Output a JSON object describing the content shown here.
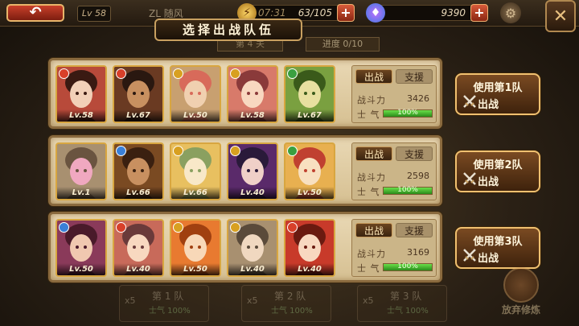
{
  "topbar": {
    "level": "Lv 58",
    "player_name": "ZL 随风",
    "energy_time": "07:31",
    "energy_value": "63/105",
    "gems_value": "9390"
  },
  "header": {
    "title": "选择出战队伍",
    "chapter": "第 4 关",
    "progress": "进度 0/10"
  },
  "teams": [
    {
      "tab_battle": "出战",
      "tab_support": "支援",
      "power_label": "战斗力",
      "power": "3426",
      "morale_label": "士  气",
      "morale_text": "100%",
      "morale_fraction": 1.0,
      "use_line1": "使用第1队",
      "use_line2": "出战",
      "heroes": [
        {
          "level": "Lv.58",
          "element": "fire",
          "palette": [
            "#b84a3a",
            "#f2d0b8",
            "#3a1a12"
          ]
        },
        {
          "level": "Lv.67",
          "element": "fire",
          "palette": [
            "#6a3a22",
            "#c89060",
            "#2a1810"
          ]
        },
        {
          "level": "Lv.50",
          "element": "light",
          "palette": [
            "#c8a070",
            "#f0d0b0",
            "#d86a5a"
          ]
        },
        {
          "level": "Lv.58",
          "element": "light",
          "palette": [
            "#d87a6a",
            "#f8d8c0",
            "#8a3a3a"
          ]
        },
        {
          "level": "Lv.67",
          "element": "wood",
          "palette": [
            "#7aa040",
            "#e8e0a0",
            "#3a5a1a"
          ]
        }
      ]
    },
    {
      "tab_battle": "出战",
      "tab_support": "支援",
      "power_label": "战斗力",
      "power": "2598",
      "morale_label": "士  气",
      "morale_text": "100%",
      "morale_fraction": 1.0,
      "use_line1": "使用第2队",
      "use_line2": "出战",
      "heroes": [
        {
          "level": "Lv.1",
          "element": "none",
          "palette": [
            "#a89070",
            "#f0a8c0",
            "#6a5440"
          ]
        },
        {
          "level": "Lv.66",
          "element": "water",
          "palette": [
            "#7a4a22",
            "#c89060",
            "#3a2010"
          ]
        },
        {
          "level": "Lv.66",
          "element": "light",
          "palette": [
            "#e8c060",
            "#f8e8c8",
            "#8aa060"
          ]
        },
        {
          "level": "Lv.40",
          "element": "light",
          "palette": [
            "#5a2a6a",
            "#f0d0c8",
            "#2a1a3a"
          ]
        },
        {
          "level": "Lv.50",
          "element": "wood",
          "palette": [
            "#e8b050",
            "#f8e0c0",
            "#c04030"
          ]
        }
      ]
    },
    {
      "tab_battle": "出战",
      "tab_support": "支援",
      "power_label": "战斗力",
      "power": "3169",
      "morale_label": "士  气",
      "morale_text": "100%",
      "morale_fraction": 1.0,
      "use_line1": "使用第3队",
      "use_line2": "出战",
      "heroes": [
        {
          "level": "Lv.50",
          "element": "water",
          "palette": [
            "#8a3a5a",
            "#f0c8b0",
            "#4a1a2a"
          ]
        },
        {
          "level": "Lv.40",
          "element": "fire",
          "palette": [
            "#c86a5a",
            "#f8d8c0",
            "#6a3a3a"
          ]
        },
        {
          "level": "Lv.50",
          "element": "light",
          "palette": [
            "#e87a30",
            "#f8d8b8",
            "#a04010"
          ]
        },
        {
          "level": "Lv.40",
          "element": "light",
          "palette": [
            "#a89070",
            "#f0d8c0",
            "#5a4a3a"
          ]
        },
        {
          "level": "Lv.40",
          "element": "fire",
          "palette": [
            "#c83a2a",
            "#f8d8c0",
            "#6a1a10"
          ]
        }
      ]
    }
  ],
  "bottom": {
    "teams": [
      {
        "label": "第 1 队",
        "mult": "x5",
        "morale": "士气 100%"
      },
      {
        "label": "第 2 队",
        "mult": "x5",
        "morale": "士气 100%"
      },
      {
        "label": "第 3 队",
        "mult": "x5",
        "morale": "士气 100%"
      }
    ],
    "abandon_label": "放弃修炼"
  },
  "colors": {
    "panel_bg": "#e2cfa6",
    "panel_border": "#8a6a3e",
    "button_gold": "#f0c070",
    "morale_green": "#4ac030",
    "element_fire": "#d8402a",
    "element_water": "#3a80d8",
    "element_light": "#d8a020",
    "element_wood": "#3aa040"
  }
}
